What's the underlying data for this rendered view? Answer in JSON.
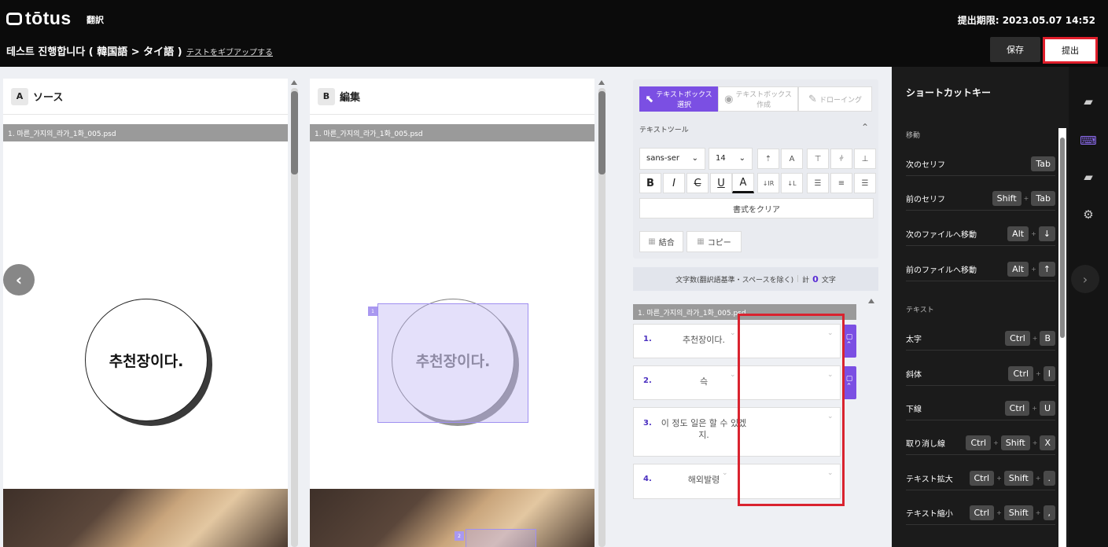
{
  "header": {
    "logo": "tōtus",
    "mode": "翻訳",
    "deadline": "提出期限: 2023.05.07 14:52",
    "title": "테스트 진행합니다 ( 韓国語 > タイ語 )",
    "giveup_link": "テストをギブアップする",
    "save_label": "保存",
    "submit_label": "提出"
  },
  "source_panel": {
    "badge": "A",
    "title": "ソース",
    "file": "1. 마른_가지의_라가_1화_005.psd",
    "bubble_text": "추천장이다."
  },
  "edit_panel": {
    "badge": "B",
    "title": "編集",
    "file": "1. 마른_가지의_라가_1화_005.psd",
    "bubble_text": "추천장이다.",
    "box1_num": "1",
    "box2_num": "2"
  },
  "tools": {
    "tab_select": "テキストボックス\n選択",
    "tab_create": "テキストボックス\n作成",
    "tab_drawing": "ドローイング",
    "text_tool_label": "テキストツール",
    "font_family": "sans-ser",
    "font_size": "14",
    "clear_format": "書式をクリア",
    "merge": "結合",
    "copy": "コピー"
  },
  "count": {
    "label": "文字数(翻訳語基準・スペースを除く)",
    "total_prefix": "計",
    "total_value": "0",
    "total_suffix": "文字"
  },
  "list": {
    "file": "1. 마른_가지의_라가_1화_005.psd",
    "rows": [
      {
        "num": "1.",
        "text": "추천장이다."
      },
      {
        "num": "2.",
        "text": "슥"
      },
      {
        "num": "3.",
        "text": "이 정도 일은 할 수 있겠지."
      },
      {
        "num": "4.",
        "text": "해외발령"
      }
    ]
  },
  "shortcuts": {
    "title": "ショートカットキー",
    "section_move": "移動",
    "section_text": "テキスト",
    "items": [
      {
        "label": "次のセリフ",
        "keys": [
          "Tab"
        ]
      },
      {
        "label": "前のセリフ",
        "keys": [
          "Shift",
          "Tab"
        ]
      },
      {
        "label": "次のファイルへ移動",
        "keys": [
          "Alt",
          "↓"
        ]
      },
      {
        "label": "前のファイルへ移動",
        "keys": [
          "Alt",
          "↑"
        ]
      },
      {
        "label": "太字",
        "keys": [
          "Ctrl",
          "B"
        ]
      },
      {
        "label": "斜体",
        "keys": [
          "Ctrl",
          "I"
        ]
      },
      {
        "label": "下線",
        "keys": [
          "Ctrl",
          "U"
        ]
      },
      {
        "label": "取り消し線",
        "keys": [
          "Ctrl",
          "Shift",
          "X"
        ]
      },
      {
        "label": "テキスト拡大",
        "keys": [
          "Ctrl",
          "Shift",
          "."
        ]
      },
      {
        "label": "テキスト縮小",
        "keys": [
          "Ctrl",
          "Shift",
          ","
        ]
      }
    ]
  },
  "colors": {
    "accent": "#7b4fe3",
    "highlight": "#d9232f",
    "topbar": "#0b0b0b"
  }
}
